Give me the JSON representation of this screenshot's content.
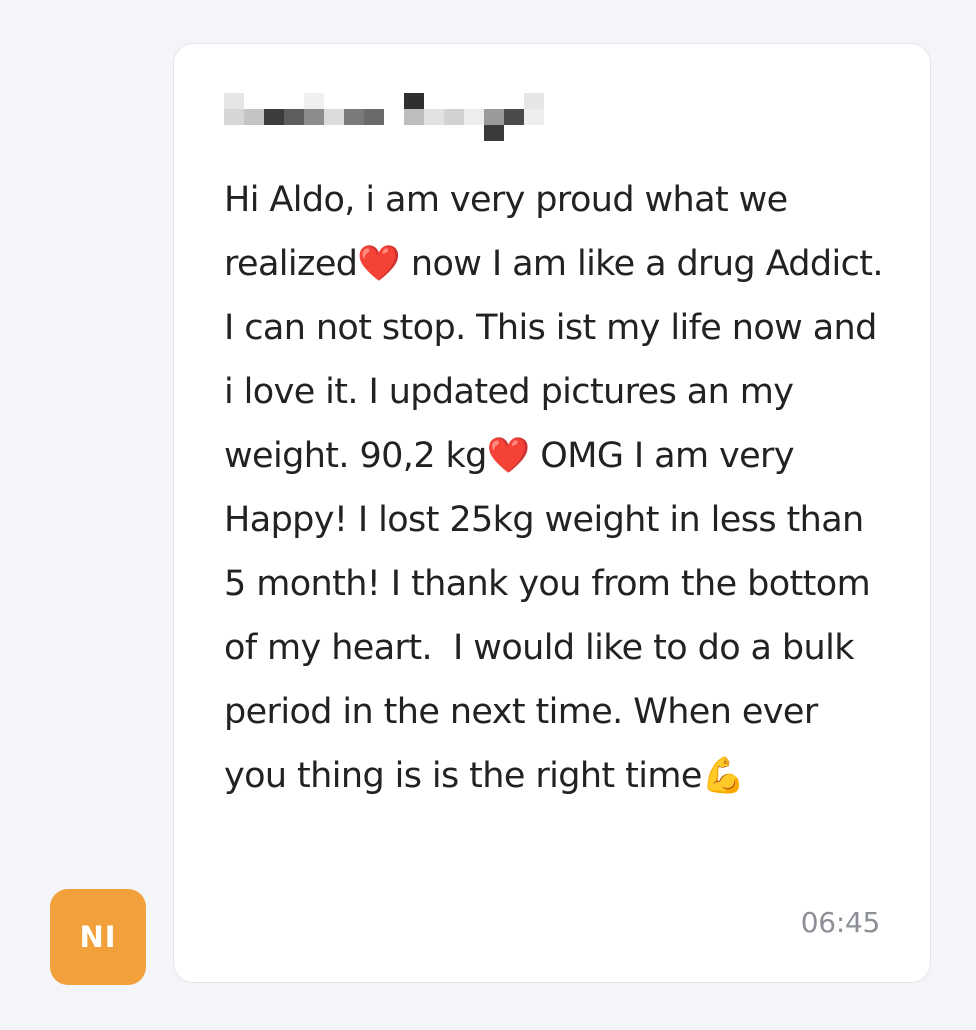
{
  "message": {
    "sender_avatar": "NI",
    "text": "Hi Aldo, i am very proud what we realized❤️ now I am like a drug Addict. I can not stop. This ist my life now and i love it. I updated pictures an my weight. 90,2 kg❤️ OMG I am very Happy! I lost 25kg weight in less than 5 month! I thank you from the bottom of my heart.  I would like to do a bulk period in the next time. When ever you thing is is the right time💪",
    "time": "06:45"
  },
  "colors": {
    "background": "#f3f5f8",
    "bubble": "#ffffff",
    "avatar": "#f2a03c",
    "text": "#222222",
    "timestamp": "#8c9096"
  }
}
